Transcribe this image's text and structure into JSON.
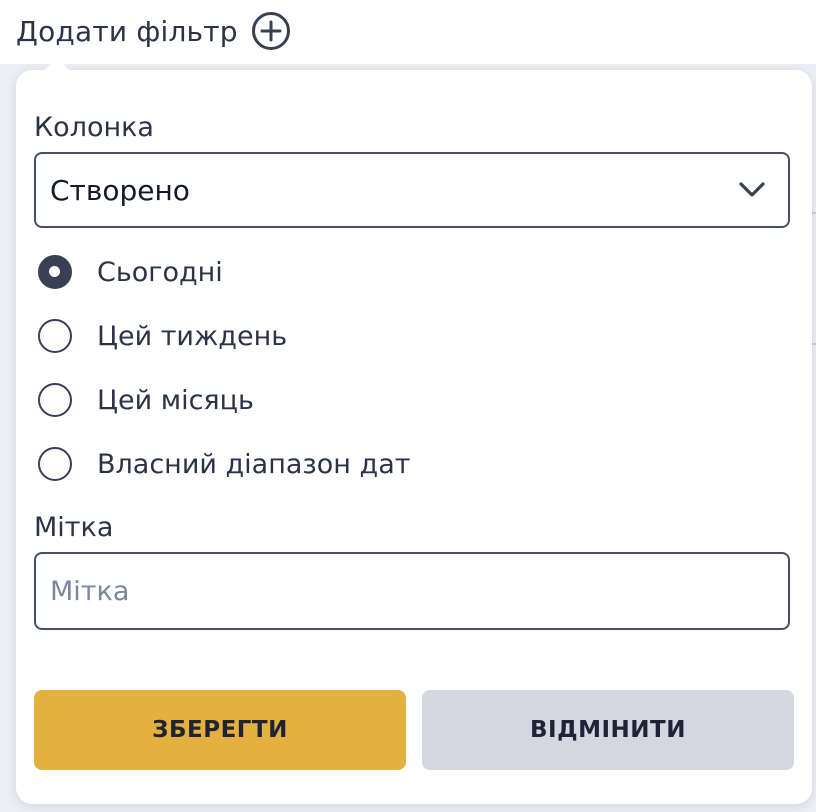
{
  "header": {
    "add_filter_label": "Додати фільтр",
    "add_filter_icon": "plus-circle-icon"
  },
  "filter_panel": {
    "column_label": "Колонка",
    "column_select": {
      "selected_value": "Створено",
      "icon": "chevron-down-icon"
    },
    "date_options": [
      {
        "label": "Сьогодні",
        "checked": true
      },
      {
        "label": "Цей тиждень",
        "checked": false
      },
      {
        "label": "Цей місяць",
        "checked": false
      },
      {
        "label": "Власний діапазон дат",
        "checked": false
      }
    ],
    "tag_label": "Мітка",
    "tag_input": {
      "value": "",
      "placeholder": "Мітка"
    },
    "save_label": "ЗБЕРЕГТИ",
    "cancel_label": "ВІДМІНИТИ"
  },
  "colors": {
    "save_button": "#e4b03f",
    "cancel_button": "#d4d7e2",
    "text": "#2c3348",
    "page_background": "#eceef3"
  }
}
